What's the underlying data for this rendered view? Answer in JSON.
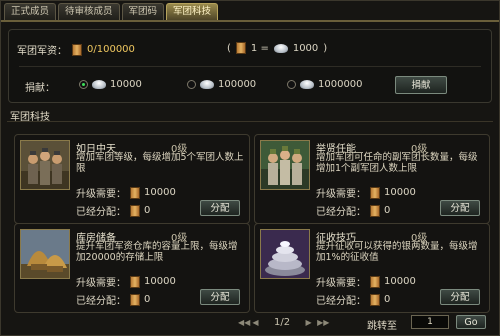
{
  "tabs": [
    {
      "label": "正式成员"
    },
    {
      "label": "待审核成员"
    },
    {
      "label": "军团码"
    },
    {
      "label": "军团科技"
    }
  ],
  "funds": {
    "label": "军团军资：",
    "value": "0/100000",
    "exchange_left": "1 =",
    "exchange_right": "1000"
  },
  "donate": {
    "label": "捐献：",
    "options": [
      {
        "value": "10000",
        "selected": true
      },
      {
        "value": "100000",
        "selected": false
      },
      {
        "value": "1000000",
        "selected": false
      }
    ],
    "button": "捐献"
  },
  "section_title": "军团科技",
  "techs": [
    {
      "name": "如日中天",
      "level": "0级",
      "desc": "增加军团等级，每级增加5个军团人数上限",
      "req_label": "升级需要：",
      "req_value": "10000",
      "asg_label": "已经分配：",
      "asg_value": "0",
      "button": "分配",
      "icon": "soldiers-icon"
    },
    {
      "name": "举贤任能",
      "level": "0级",
      "desc": "增加军团可任命的副军团长数量，每级增加1个副军团人数上限",
      "req_label": "升级需要：",
      "req_value": "10000",
      "asg_label": "已经分配：",
      "asg_value": "0",
      "button": "分配",
      "icon": "officers-icon"
    },
    {
      "name": "库房储备",
      "level": "0级",
      "desc": "提升军团军资仓库的容量上限，每级增加20000的存储上限",
      "req_label": "升级需要：",
      "req_value": "10000",
      "asg_label": "已经分配：",
      "asg_value": "0",
      "button": "分配",
      "icon": "granary-icon"
    },
    {
      "name": "征收技巧",
      "level": "0级",
      "desc": "提升征收可以获得的银两数量，每级增加1%的征收值",
      "req_label": "升级需要：",
      "req_value": "10000",
      "asg_label": "已经分配：",
      "asg_value": "0",
      "button": "分配",
      "icon": "silver-pile-icon"
    }
  ],
  "pagination": {
    "page_text": "1/2",
    "jump_label": "跳转至",
    "input_value": "1",
    "go_label": "Go"
  }
}
